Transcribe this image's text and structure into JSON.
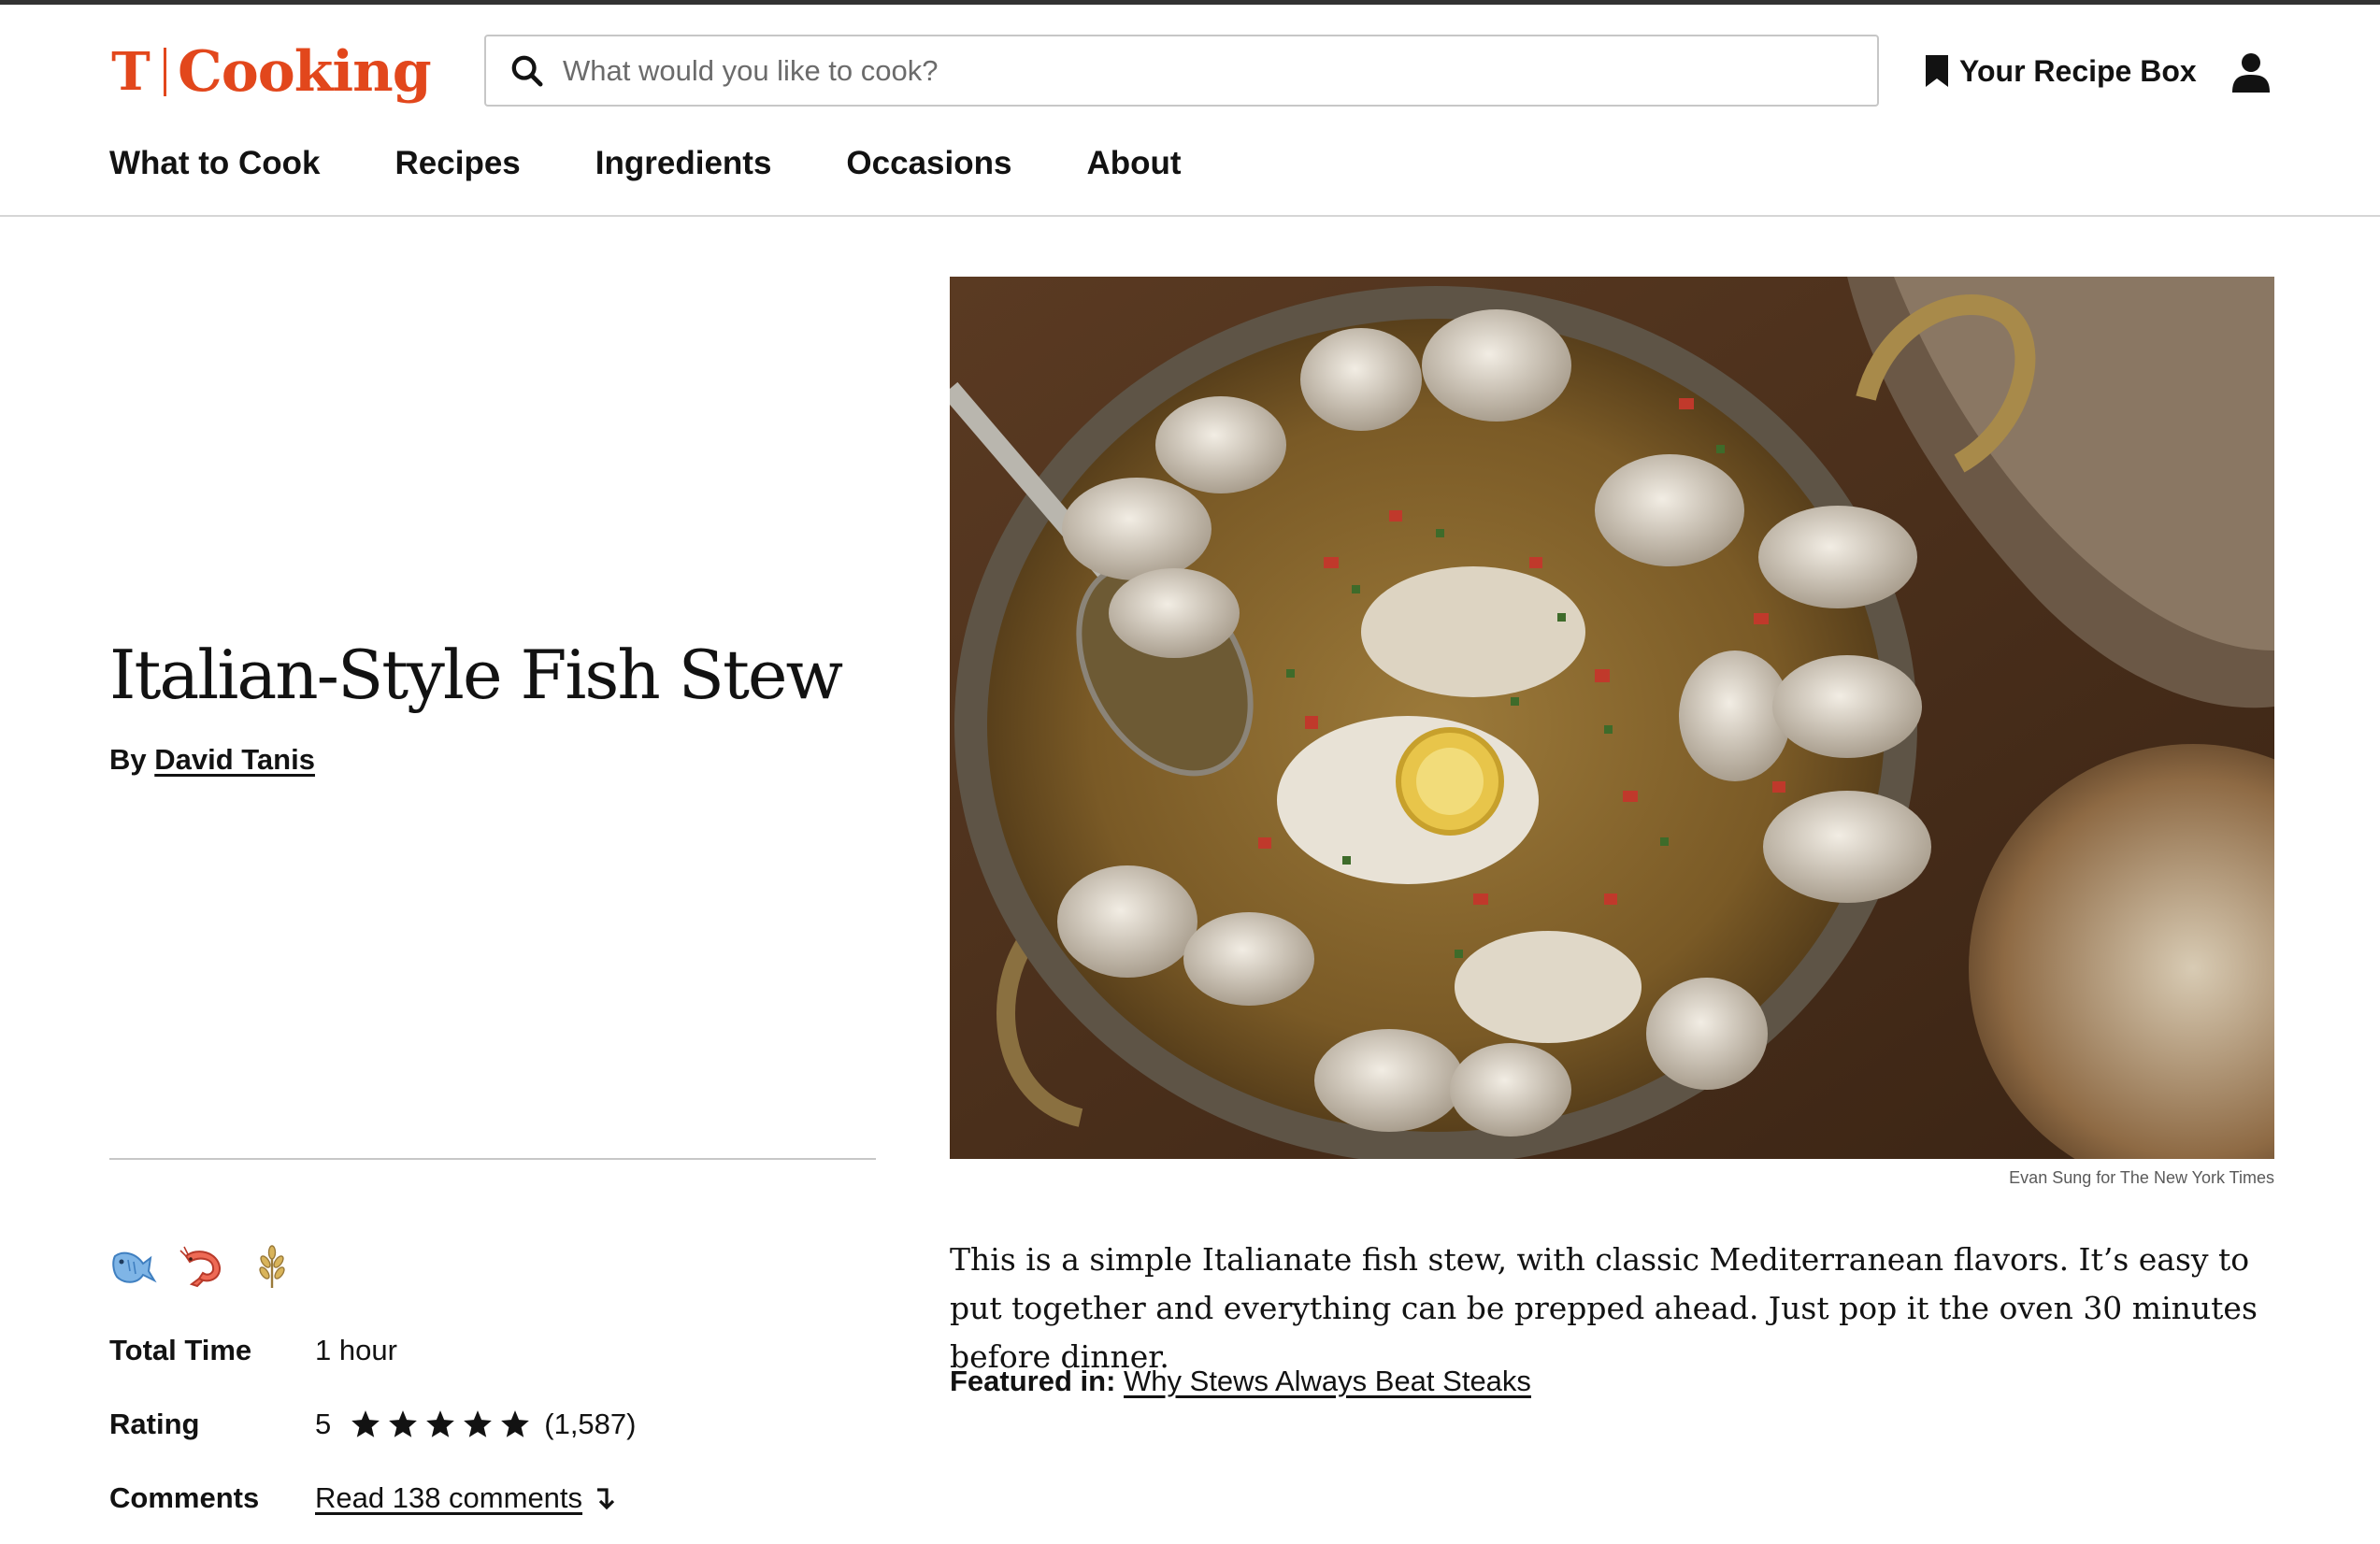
{
  "header": {
    "logo_word": "Cooking",
    "search_placeholder": "What would you like to cook?",
    "recipe_box_label": "Your Recipe Box"
  },
  "nav": [
    {
      "label": "What to Cook"
    },
    {
      "label": "Recipes"
    },
    {
      "label": "Ingredients"
    },
    {
      "label": "Occasions"
    },
    {
      "label": "About"
    }
  ],
  "recipe": {
    "title": "Italian-Style Fish Stew",
    "by_prefix": "By",
    "author": "David Tanis",
    "photo_credit": "Evan Sung for The New York Times",
    "description": "This is a simple Italianate fish stew, with classic Mediterranean flavors. It’s easy to put together and everything can be prepped ahead. Just pop it the oven 30 minutes before dinner.",
    "featured_label": "Featured in:",
    "featured_link": "Why Stews Always Beat Steaks",
    "tag_icons": [
      "fish-icon",
      "shrimp-icon",
      "wheat-icon"
    ],
    "meta": {
      "total_time_label": "Total Time",
      "total_time": "1 hour",
      "rating_label": "Rating",
      "rating_value": "5",
      "stars": 5,
      "rating_count": "(1,587)",
      "comments_label": "Comments",
      "comments_link": "Read 138 comments"
    }
  },
  "colors": {
    "brand": "#e2471c",
    "text": "#121212",
    "divider": "#c7c7c7"
  }
}
